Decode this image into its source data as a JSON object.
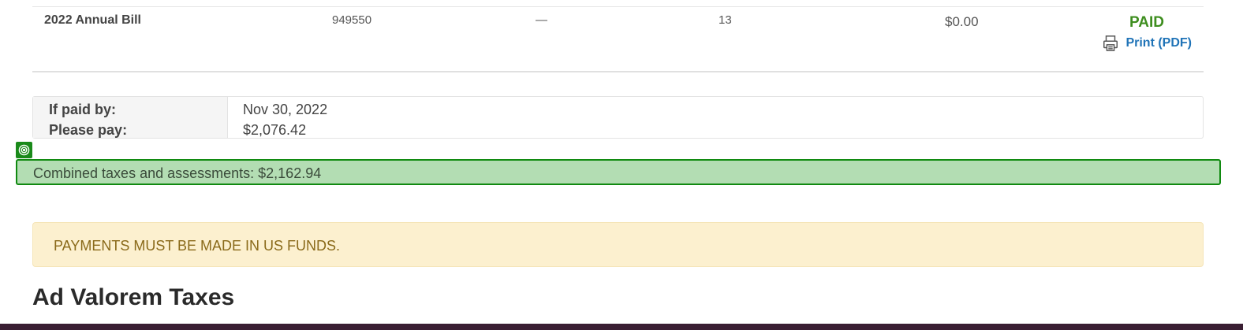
{
  "bill": {
    "title": "2022 Annual Bill",
    "number": "949550",
    "dash": "—",
    "count": "13",
    "amount": "$0.00",
    "status": "PAID",
    "print_label": "Print (PDF)"
  },
  "payment": {
    "if_paid_label": "If paid by:",
    "please_pay_label": "Please pay:",
    "if_paid_value": "Nov 30, 2022",
    "please_pay_value": "$2,076.42"
  },
  "combined": {
    "text": "Combined taxes and assessments: $2,162.94"
  },
  "alert": {
    "text": "PAYMENTS MUST BE MADE IN US FUNDS."
  },
  "section": {
    "title": "Ad Valorem Taxes"
  },
  "colors": {
    "paid": "#3e8e1f",
    "link": "#1f73b7",
    "highlight_bg": "#b3ddb3",
    "highlight_border": "#118a11",
    "alert_bg": "#fcf0cf"
  }
}
